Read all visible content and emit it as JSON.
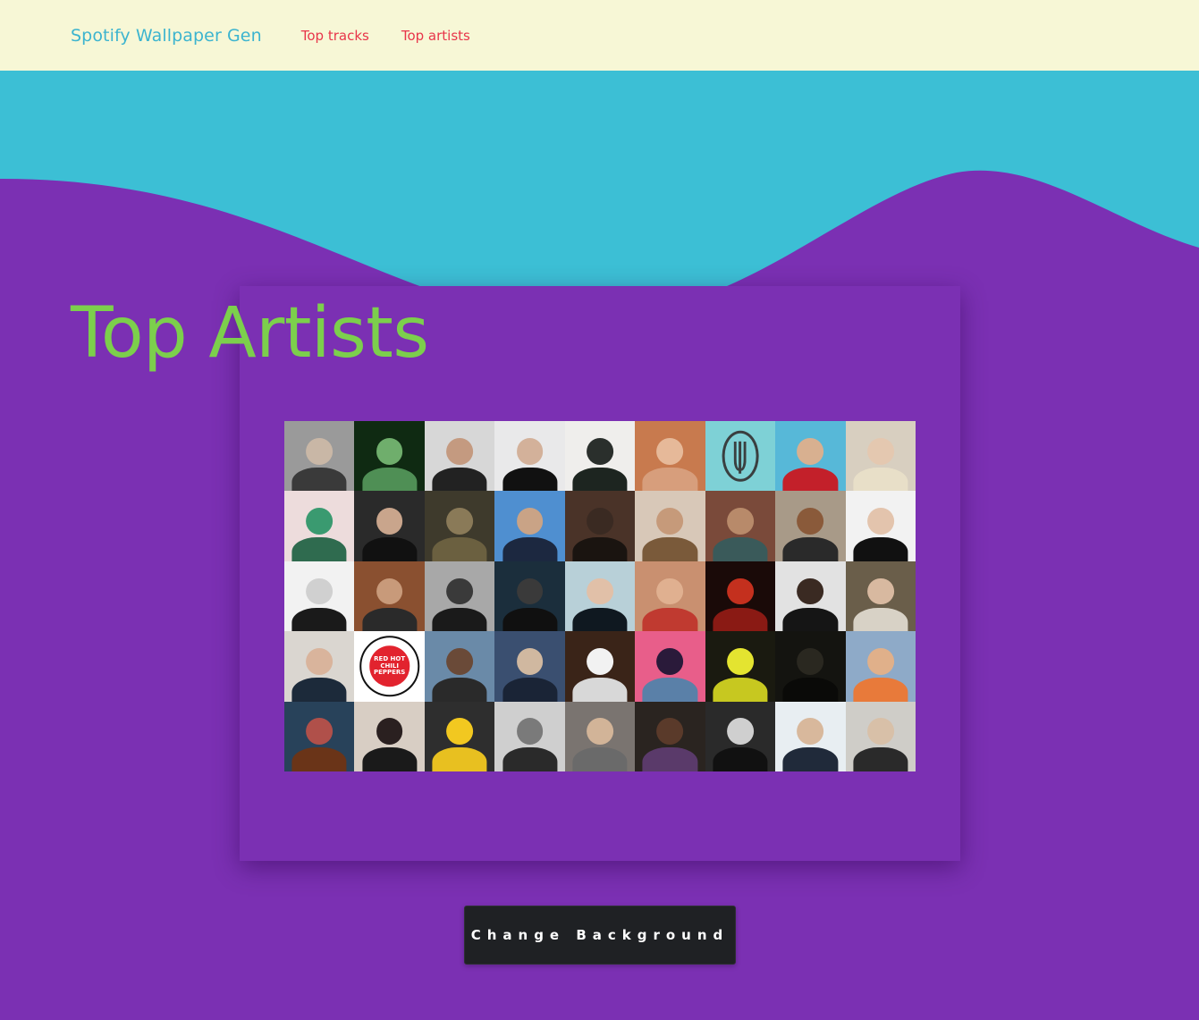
{
  "navbar": {
    "brand": "Spotify Wallpaper Gen",
    "links": [
      "Top tracks",
      "Top artists"
    ]
  },
  "page_title": "Top Artists",
  "button_label": "Change Background",
  "colors": {
    "navbar_bg": "#f7f7d6",
    "hero_teal": "#3cbfd5",
    "page_purple": "#7b30b3",
    "title_green": "#7ccf4c",
    "brand_blue": "#3cb4cf",
    "link_red": "#e8354a",
    "button_bg": "#1f2124"
  },
  "artist_tiles": [
    {
      "bg": "#9a9a9a",
      "fg": "#3a3a3a",
      "head": "#c9b7a6"
    },
    {
      "bg": "#0f2a12",
      "fg": "#4f8f55",
      "head": "#6fae6c"
    },
    {
      "bg": "#d7d7d7",
      "fg": "#222222",
      "head": "#c49a80"
    },
    {
      "bg": "#e9e9ea",
      "fg": "#111111",
      "head": "#d3b19a"
    },
    {
      "bg": "#efeeec",
      "fg": "#1d2520",
      "head": "#2a2f2c"
    },
    {
      "bg": "#c87a4e",
      "fg": "#d79e7c",
      "head": "#e6b999"
    },
    {
      "bg": "#7ed1d6",
      "fg": "#3a3f40",
      "head": "#7ed1d6",
      "icon": "trident-logo-icon"
    },
    {
      "bg": "#57b8d8",
      "fg": "#c3202a",
      "head": "#d8b090"
    },
    {
      "bg": "#d8cfc0",
      "fg": "#e8dfc8",
      "head": "#e4c8b0"
    },
    {
      "bg": "#eddcdc",
      "fg": "#2f6b4f",
      "head": "#3a9a70"
    },
    {
      "bg": "#2a2a2a",
      "fg": "#111111",
      "head": "#c9a58c"
    },
    {
      "bg": "#3e3a2c",
      "fg": "#6b6040",
      "head": "#8a7a58"
    },
    {
      "bg": "#4f8fd0",
      "fg": "#1c2840",
      "head": "#c9a386"
    },
    {
      "bg": "#4a3328",
      "fg": "#1a1410",
      "head": "#3a2a22"
    },
    {
      "bg": "#d8c8b8",
      "fg": "#7a5a3a",
      "head": "#c69a7a"
    },
    {
      "bg": "#7a4a3a",
      "fg": "#3a5a5a",
      "head": "#b88a6a"
    },
    {
      "bg": "#a89a88",
      "fg": "#2a2a2a",
      "head": "#8a5a3a"
    },
    {
      "bg": "#f2f2f2",
      "fg": "#111111",
      "head": "#e3c4ad"
    },
    {
      "bg": "#f2f2f2",
      "fg": "#1a1a1a",
      "head": "#d0d0d0"
    },
    {
      "bg": "#8a5030",
      "fg": "#2a2a2a",
      "head": "#c89a7a"
    },
    {
      "bg": "#a8a8a8",
      "fg": "#1a1a1a",
      "head": "#3a3a3a"
    },
    {
      "bg": "#1b2e3c",
      "fg": "#101010",
      "head": "#3a3a3a"
    },
    {
      "bg": "#b8d0d8",
      "fg": "#0f1820",
      "head": "#e1c0a8"
    },
    {
      "bg": "#c99070",
      "fg": "#c03a30",
      "head": "#e0b090"
    },
    {
      "bg": "#1a0a08",
      "fg": "#8a1a14",
      "head": "#c4301e"
    },
    {
      "bg": "#e2e2e2",
      "fg": "#151515",
      "head": "#3a2a22"
    },
    {
      "bg": "#6a5e4a",
      "fg": "#d8d2c6",
      "head": "#d8b9a0"
    },
    {
      "bg": "#dad6d0",
      "fg": "#1c2a3a",
      "head": "#d9b49c"
    },
    {
      "bg": "#ffffff",
      "fg": "#e2232e",
      "head": "#e2232e",
      "logo": "RED HOT CHILI PEPPERS"
    },
    {
      "bg": "#6a8aa8",
      "fg": "#2a2a2a",
      "head": "#6a4a38"
    },
    {
      "bg": "#3a4f70",
      "fg": "#1a2436",
      "head": "#d0b8a0"
    },
    {
      "bg": "#3a2418",
      "fg": "#d8d8d8",
      "head": "#f2f2f2"
    },
    {
      "bg": "#e85e8a",
      "fg": "#5a80a8",
      "head": "#2a1a3a"
    },
    {
      "bg": "#1a1a10",
      "fg": "#c7c820",
      "head": "#e4e430"
    },
    {
      "bg": "#141410",
      "fg": "#0a0a08",
      "head": "#2a2820"
    },
    {
      "bg": "#8eaac8",
      "fg": "#e87a3a",
      "head": "#e0b08a"
    },
    {
      "bg": "#28425a",
      "fg": "#6a3418",
      "head": "#b0504a"
    },
    {
      "bg": "#d8cec4",
      "fg": "#1a1a1a",
      "head": "#2a2020"
    },
    {
      "bg": "#2e2e2e",
      "fg": "#e8c020",
      "head": "#f2c820"
    },
    {
      "bg": "#cfcfcf",
      "fg": "#2a2a2a",
      "head": "#7a7a7a"
    },
    {
      "bg": "#7a7470",
      "fg": "#6a6a6a",
      "head": "#d2b498"
    },
    {
      "bg": "#2a2420",
      "fg": "#5a3a6a",
      "head": "#5a3a2a"
    },
    {
      "bg": "#2a2a2a",
      "fg": "#111111",
      "head": "#cfcfcf"
    },
    {
      "bg": "#e8eef2",
      "fg": "#202a3a",
      "head": "#d8b89c"
    },
    {
      "bg": "#cfcdc8",
      "fg": "#2a2a2a",
      "head": "#d8c0a8"
    }
  ]
}
